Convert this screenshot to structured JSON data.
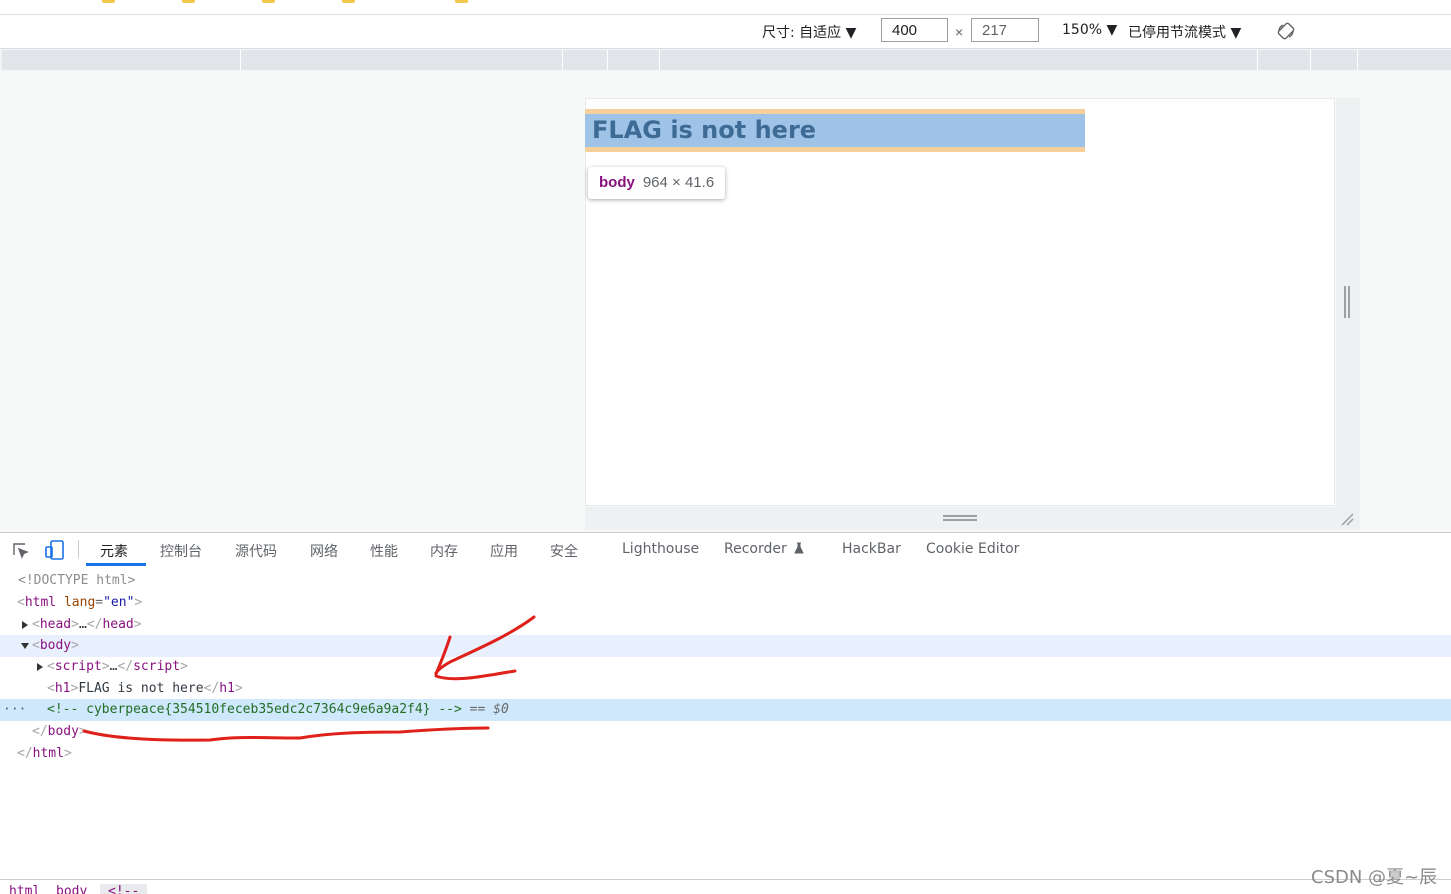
{
  "device_toolbar": {
    "dimensions_label": "尺寸: 自适应 ▼",
    "width_value": "400",
    "height_value": "217",
    "times_sign": "×",
    "zoom": "150% ▼",
    "throttle": "已停用节流模式 ▼"
  },
  "preview": {
    "h1_text": "FLAG is not here",
    "tooltip_tag": "body",
    "tooltip_dims": "964 × 41.6"
  },
  "devtools": {
    "tabs": [
      "元素",
      "控制台",
      "源代码",
      "网络",
      "性能",
      "内存",
      "应用",
      "安全",
      "Lighthouse",
      "Recorder",
      "HackBar",
      "Cookie Editor"
    ],
    "active_tab": "元素"
  },
  "dom": {
    "doctype": "<!DOCTYPE html>",
    "html_tag": "html",
    "lang_attr": "lang",
    "lang_value": "\"en\"",
    "head_tag": "head",
    "body_tag": "body",
    "script_tag": "script",
    "h1_tag": "h1",
    "h1_text": "FLAG is not here",
    "comment": "<!-- cyberpeace{354510feceb35edc2c7364c9e6a9a2f4} -->",
    "selected_suffix": "== $0",
    "ellipsis": "…",
    "gutter_dots": "···"
  },
  "breadcrumbs": [
    "html",
    "body",
    "<!--"
  ],
  "watermark": "CSDN @夏~辰",
  "colors": {
    "accent": "#1a73e8",
    "tag": "#881280",
    "comment": "#236e25",
    "margin_overlay": "#f6cf9a",
    "content_overlay": "#9fc3e6",
    "annotation": "#e0201a"
  }
}
